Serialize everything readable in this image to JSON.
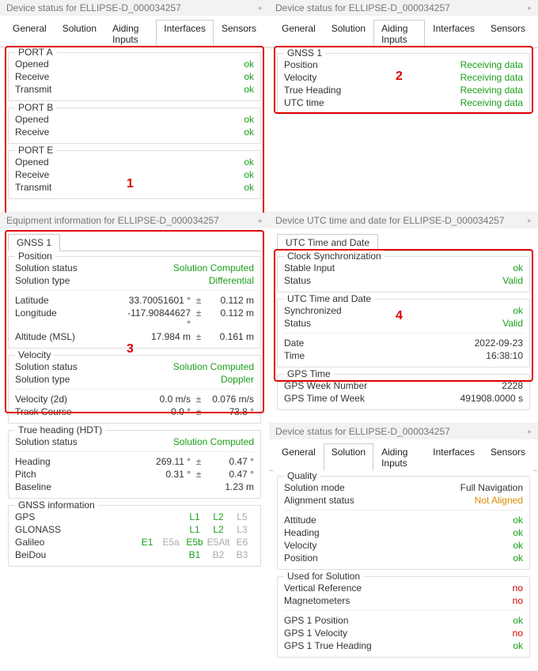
{
  "deviceTitle": "Device status for ELLIPSE-D_000034257",
  "equipTitle": "Equipment information for ELLIPSE-D_000034257",
  "utcTitle": "Device UTC time and date for ELLIPSE-D_000034257",
  "tabs": {
    "general": "General",
    "solution": "Solution",
    "aiding": "Aiding Inputs",
    "interfaces": "Interfaces",
    "sensors": "Sensors"
  },
  "interfaces": {
    "portA": {
      "title": "PORT A",
      "opened": "ok",
      "receive": "ok",
      "transmit": "ok"
    },
    "portB": {
      "title": "PORT B",
      "opened": "ok",
      "receive": "ok"
    },
    "portE": {
      "title": "PORT E",
      "opened": "ok",
      "receive": "ok",
      "transmit": "ok"
    }
  },
  "labels": {
    "opened": "Opened",
    "receive": "Receive",
    "transmit": "Transmit",
    "position": "Position",
    "velocity": "Velocity",
    "trueHeading": "True Heading",
    "utcTime": "UTC time",
    "solStatus": "Solution status",
    "solType": "Solution type",
    "lat": "Latitude",
    "lon": "Longitude",
    "alt": "Altitude (MSL)",
    "vel2d": "Velocity (2d)",
    "track": "Track Course",
    "heading": "Heading",
    "pitch": "Pitch",
    "baseline": "Baseline",
    "gps": "GPS",
    "glonass": "GLONASS",
    "galileo": "Galileo",
    "beidou": "BeiDou",
    "stableInput": "Stable Input",
    "status": "Status",
    "synced": "Synchronized",
    "date": "Date",
    "time": "Time",
    "gpsWeek": "GPS Week Number",
    "gpsTow": "GPS Time of Week",
    "solMode": "Solution mode",
    "alignStatus": "Alignment status",
    "attitude": "Attitude",
    "vertRef": "Vertical Reference",
    "magneto": "Magnetometers",
    "gps1pos": "GPS 1 Position",
    "gps1vel": "GPS 1 Velocity",
    "gps1hdg": "GPS 1 True Heading"
  },
  "aiding": {
    "title": "GNSS 1",
    "position": "Receiving data",
    "velocity": "Receiving data",
    "trueHeading": "Receiving data",
    "utcTime": "Receiving data"
  },
  "gnss1Tab": "GNSS 1",
  "posGroup": {
    "title": "Position",
    "solStatus": "Solution Computed",
    "solType": "Differential",
    "lat": "33.70051601 °",
    "latAcc": "0.112 m",
    "lon": "-117.90844627 °",
    "lonAcc": "0.112 m",
    "alt": "17.984 m",
    "altAcc": "0.161 m"
  },
  "velGroup": {
    "title": "Velocity",
    "solStatus": "Solution Computed",
    "solType": "Doppler",
    "vel2d": "0.0 m/s",
    "vel2dAcc": "0.076 m/s",
    "track": "0.0 °",
    "trackAcc": "73.8 °"
  },
  "hdtGroup": {
    "title": "True heading (HDT)",
    "solStatus": "Solution Computed",
    "heading": "269.11 °",
    "headingAcc": "0.47 °",
    "pitch": "0.31 °",
    "pitchAcc": "0.47 °",
    "baseline": "1.23 m"
  },
  "ginfo": {
    "title": "GNSS information",
    "gps": {
      "c": [
        "",
        "",
        "L1",
        "L2",
        "L5"
      ],
      "cls": [
        "",
        "",
        "ok",
        "ok",
        "dim"
      ]
    },
    "glonass": {
      "c": [
        "",
        "",
        "L1",
        "L2",
        "L3"
      ],
      "cls": [
        "",
        "",
        "ok",
        "ok",
        "dim"
      ]
    },
    "galileo": {
      "c": [
        "E1",
        "E5a",
        "E5b",
        "E5Alt",
        "E6"
      ],
      "cls": [
        "ok",
        "dim",
        "ok",
        "dim",
        "dim"
      ]
    },
    "beidou": {
      "c": [
        "",
        "",
        "B1",
        "B2",
        "B3"
      ],
      "cls": [
        "",
        "",
        "ok",
        "dim",
        "dim"
      ]
    }
  },
  "utc": {
    "tab": "UTC Time and Date",
    "clockTitle": "Clock Synchronization",
    "stableInput": "ok",
    "clockStatus": "Valid",
    "utcTitle": "UTC Time and Date",
    "synced": "ok",
    "utcStatus": "Valid",
    "date": "2022-09-23",
    "time": "16:38:10",
    "gpsTitle": "GPS Time",
    "gpsWeek": "2228",
    "gpsTow": "491908.0000 s"
  },
  "solution": {
    "qualityTitle": "Quality",
    "solMode": "Full Navigation",
    "alignStatus": "Not Aligned",
    "attitude": "ok",
    "heading": "ok",
    "velocity": "ok",
    "position": "ok",
    "usedTitle": "Used for Solution",
    "vertRef": "no",
    "magneto": "no",
    "gps1pos": "ok",
    "gps1vel": "no",
    "gps1hdg": "ok"
  },
  "pm": "±"
}
